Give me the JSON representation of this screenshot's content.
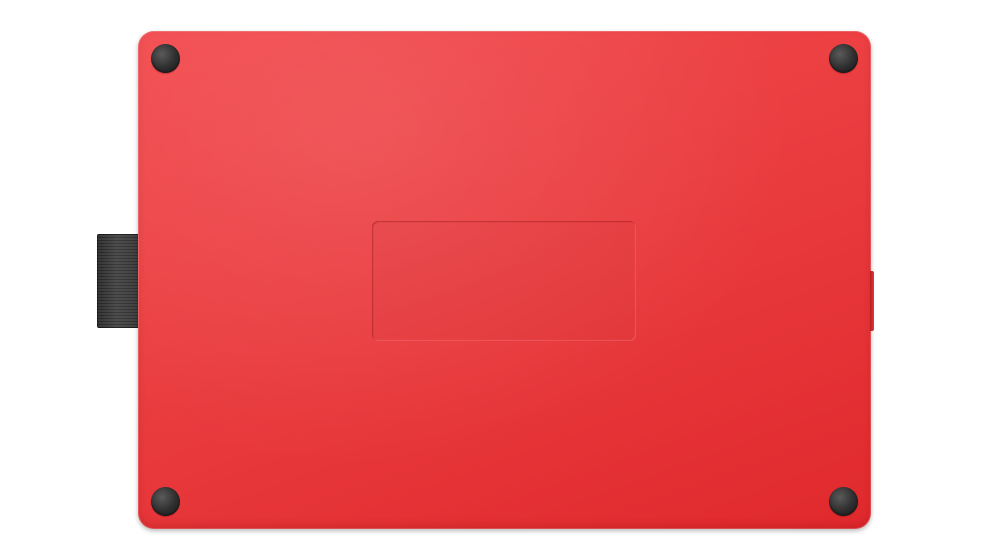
{
  "scene": {
    "subject": "graphics-tablet-underside",
    "colors": {
      "background": "#ffffff",
      "tablet_body": "#e9383c",
      "rubber_feet": "#2e2e2e",
      "cable_clip": "#3a3a3a"
    },
    "parts": [
      "cable-clip",
      "tablet-body",
      "rubber-foot-top-left",
      "rubber-foot-top-right",
      "rubber-foot-bottom-left",
      "rubber-foot-bottom-right",
      "label-recess"
    ]
  }
}
